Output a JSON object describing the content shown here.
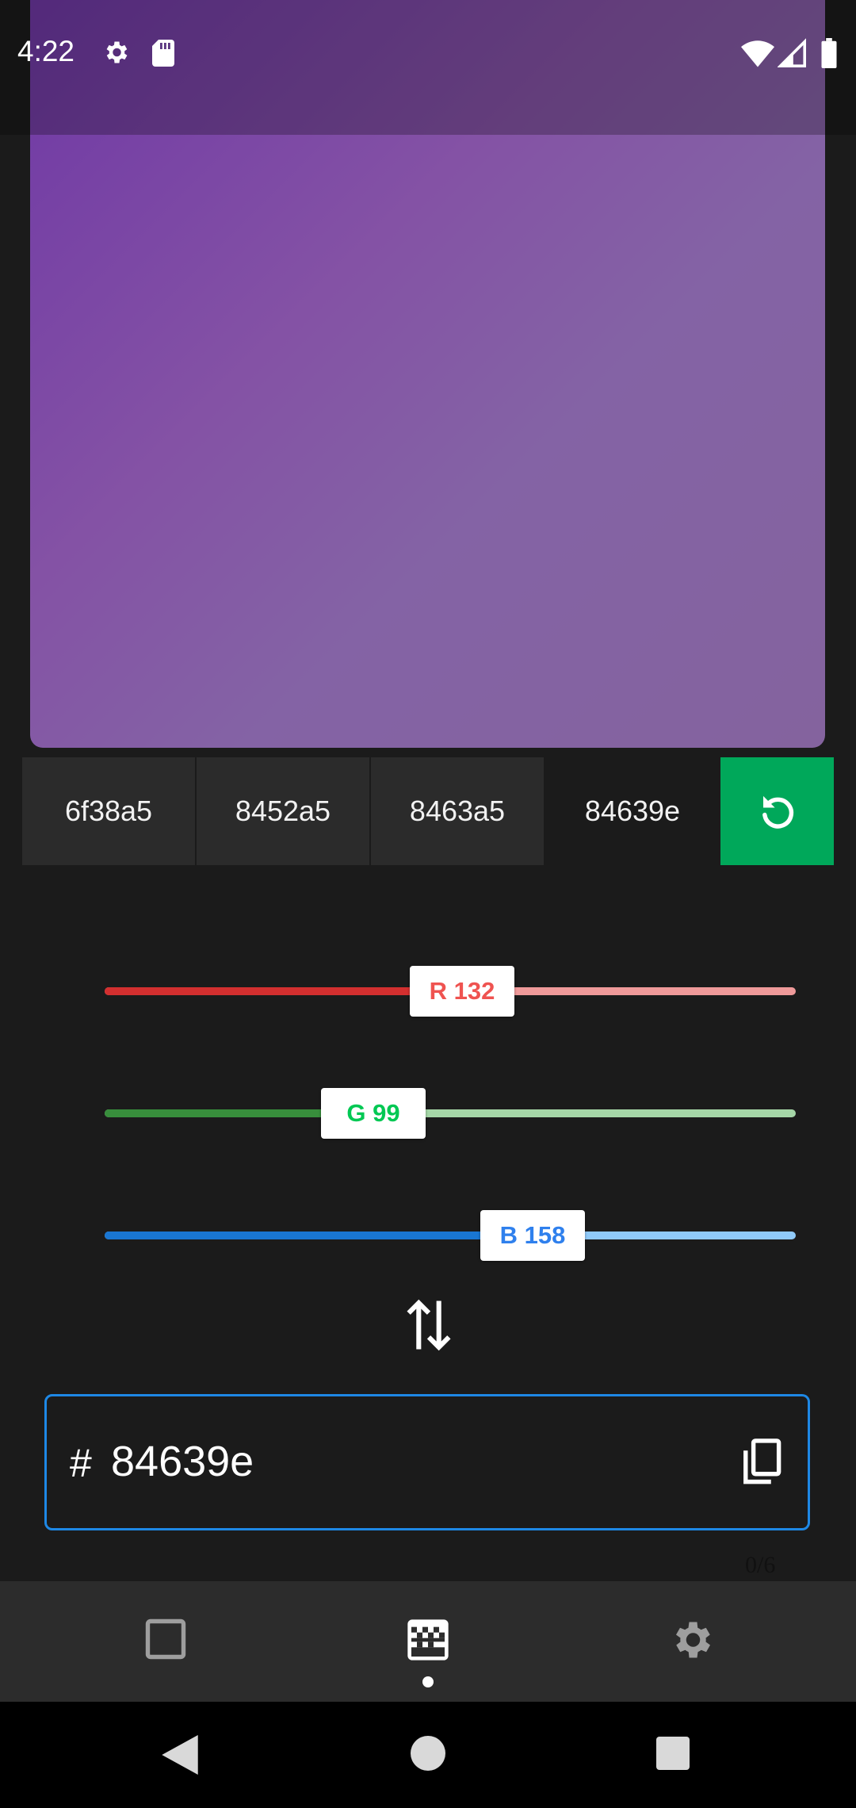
{
  "status_bar": {
    "time": "4:22",
    "icons": [
      "gear-icon",
      "sd-card-icon",
      "wifi-icon",
      "signal-icon",
      "battery-icon"
    ]
  },
  "preview": {
    "gradient_colors": [
      "#6f38a5",
      "#8452a5",
      "#8463a5",
      "#84639e"
    ]
  },
  "history": {
    "items": [
      {
        "label": "6f38a5",
        "color": "#6f38a5"
      },
      {
        "label": "8452a5",
        "color": "#8452a5"
      },
      {
        "label": "8463a5",
        "color": "#8463a5"
      },
      {
        "label": "84639e",
        "color": "#84639e"
      }
    ],
    "reset_icon": "reset-icon",
    "reset_color": "#00a85a"
  },
  "sliders": {
    "red": {
      "label": "R 132",
      "value": 132,
      "max": 255,
      "active_color": "#d32f2f",
      "inactive_color": "#ef9a9a",
      "text_color": "#ef5350"
    },
    "green": {
      "label": "G 99",
      "value": 99,
      "max": 255,
      "active_color": "#388e3c",
      "inactive_color": "#a5d6a7",
      "text_color": "#00c853"
    },
    "blue": {
      "label": "B 158",
      "value": 158,
      "max": 255,
      "active_color": "#1976d2",
      "inactive_color": "#90caf9",
      "text_color": "#2f80ed"
    }
  },
  "swap_icon": "swap-vertical-icon",
  "hex_input": {
    "prefix": "#",
    "value": "84639e",
    "counter": "0/6",
    "copy_icon": "copy-icon",
    "border_color": "#1e88e5"
  },
  "bottom_nav": {
    "items": [
      "square-icon",
      "palette-icon",
      "settings-icon"
    ],
    "selected": 1
  },
  "system_nav": [
    "back-icon",
    "home-icon",
    "recents-icon"
  ]
}
